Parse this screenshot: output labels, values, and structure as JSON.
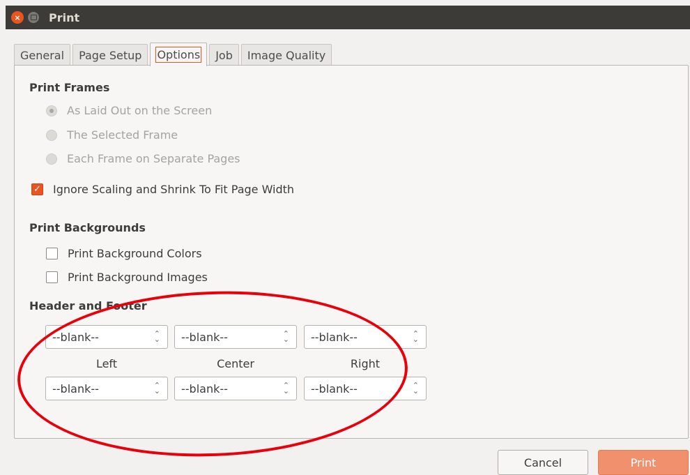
{
  "window": {
    "title": "Print"
  },
  "tabs": [
    {
      "label": "General"
    },
    {
      "label": "Page Setup"
    },
    {
      "label": "Options"
    },
    {
      "label": "Job"
    },
    {
      "label": "Image Quality"
    }
  ],
  "print_frames": {
    "title": "Print Frames",
    "options": [
      {
        "label": "As Laid Out on the Screen",
        "selected": true
      },
      {
        "label": "The Selected Frame",
        "selected": false
      },
      {
        "label": "Each Frame on Separate Pages",
        "selected": false
      }
    ]
  },
  "ignore_scaling": {
    "label": "Ignore Scaling and Shrink To Fit Page Width",
    "checked": true
  },
  "print_backgrounds": {
    "title": "Print Backgrounds",
    "options": [
      {
        "label": "Print Background Colors",
        "checked": false
      },
      {
        "label": "Print Background Images",
        "checked": false
      }
    ]
  },
  "header_footer": {
    "title": "Header and Footer",
    "header": {
      "left": "--blank--",
      "center": "--blank--",
      "right": "--blank--"
    },
    "labels": {
      "left": "Left",
      "center": "Center",
      "right": "Right"
    },
    "footer": {
      "left": "--blank--",
      "center": "--blank--",
      "right": "--blank--"
    }
  },
  "buttons": {
    "cancel": "Cancel",
    "print": "Print"
  },
  "colors": {
    "accent": "#e95420",
    "annotation": "#e8000b",
    "titlebar": "#3c3b37"
  },
  "icons": {
    "close": "close-icon",
    "minimize": "minimize-icon",
    "spin": "up-down-arrows-icon"
  }
}
